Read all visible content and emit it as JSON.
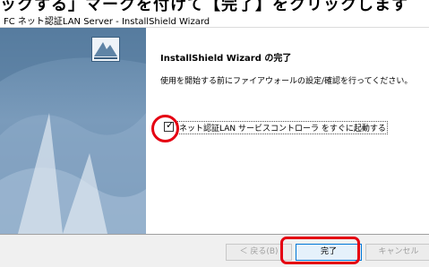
{
  "caption": {
    "text": "ックする」マークを付けて【完了】をクリックします"
  },
  "window": {
    "title": "FC ネット認証LAN Server - InstallShield Wizard"
  },
  "content": {
    "heading": "InstallShield Wizard の完了",
    "message": "使用を開始する前にファイアウォールの設定/確認を行ってください。",
    "checkbox": {
      "checked": true,
      "mark": "✓",
      "label": "ネット認証LAN サービスコントローラ をすぐに起動する"
    }
  },
  "buttons": {
    "back": "＜ 戻る(B)",
    "finish": "完了",
    "cancel": "キャンセル"
  },
  "colors": {
    "highlight": "#e50012",
    "panel_blue": "#6a8db0",
    "default_button_border": "#0078d7"
  },
  "icons": {
    "installer": "installshield-logo-icon"
  }
}
